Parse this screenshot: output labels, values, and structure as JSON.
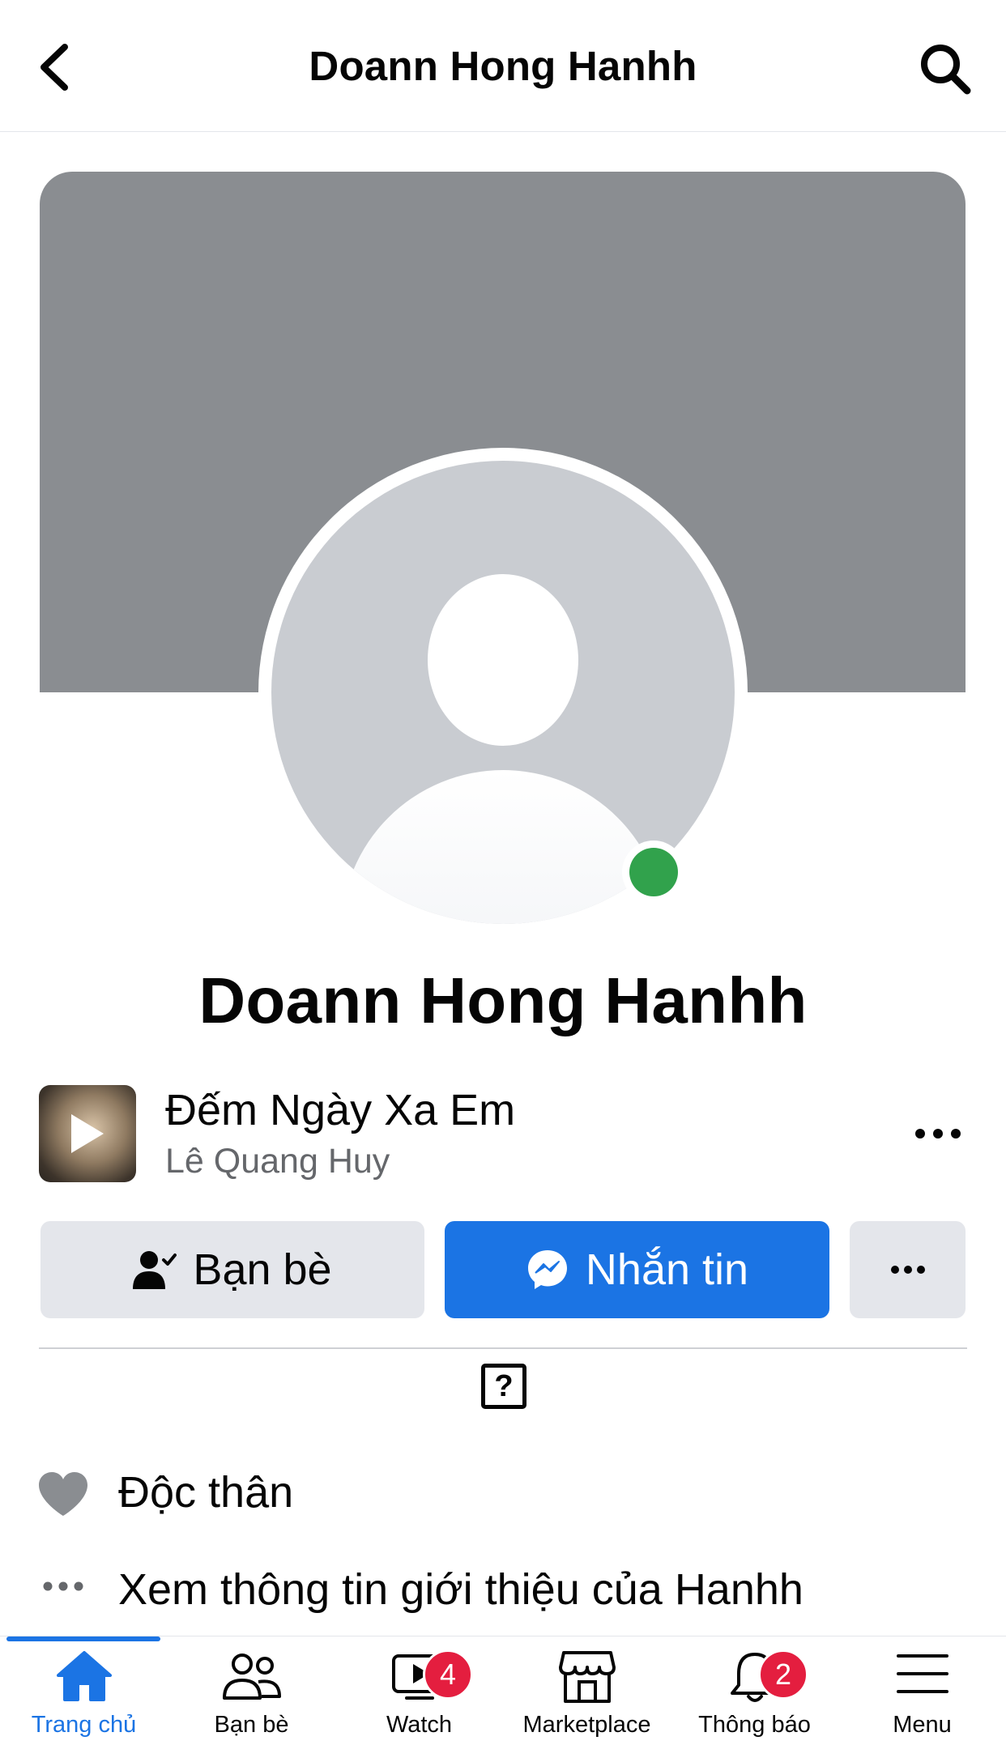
{
  "header": {
    "title": "Doann Hong Hanhh"
  },
  "profile": {
    "name": "Doann Hong Hanhh",
    "online": true
  },
  "profile_music": {
    "song": "Đếm Ngày Xa Em",
    "artist": "Lê Quang Huy"
  },
  "actions": {
    "friends_label": "Bạn bè",
    "message_label": "Nhắn tin"
  },
  "info": {
    "relationship": "Độc thân",
    "see_about": "Xem thông tin giới thiệu của Hanhh"
  },
  "bottom_nav": {
    "items": [
      {
        "label": "Trang chủ",
        "icon": "home-icon",
        "active": true
      },
      {
        "label": "Bạn bè",
        "icon": "friends-icon"
      },
      {
        "label": "Watch",
        "icon": "watch-icon",
        "badge": "4"
      },
      {
        "label": "Marketplace",
        "icon": "marketplace-icon"
      },
      {
        "label": "Thông báo",
        "icon": "bell-icon",
        "badge": "2"
      },
      {
        "label": "Menu",
        "icon": "menu-icon"
      }
    ]
  },
  "colors": {
    "accent": "#1b74e4",
    "online": "#31a24c",
    "badge": "#e41e3f",
    "cover": "#8a8d91"
  }
}
